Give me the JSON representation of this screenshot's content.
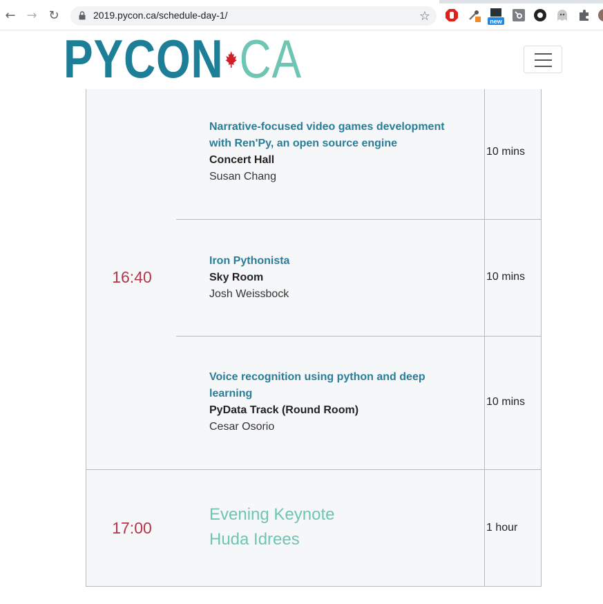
{
  "browser": {
    "url": "2019.pycon.ca/schedule-day-1/",
    "extensions": [
      "adblock-icon",
      "eyedropper-icon",
      "new-extension-icon",
      "hubspot-icon",
      "github-icon",
      "ghost-icon",
      "puzzle-icon",
      "avatar"
    ],
    "new_badge": "new"
  },
  "header": {
    "logo_left": "PYCON",
    "logo_right": "CA",
    "brand_color": "#1d7f97",
    "accent_color": "#6fc5b3"
  },
  "schedule": {
    "slots": [
      {
        "time": "16:40",
        "talks": [
          {
            "title_lines": [
              "Narrative-focused video games development",
              "with Ren'Py, an open source engine"
            ],
            "room": "Concert Hall",
            "speaker": "Susan Chang",
            "duration": "10 mins"
          },
          {
            "title_lines": [
              "Iron Pythonista"
            ],
            "room": "Sky Room",
            "speaker": "Josh Weissbock",
            "duration": "10 mins"
          },
          {
            "title_lines": [
              "Voice recognition using python and deep",
              "learning"
            ],
            "room": "PyData Track (Round Room)",
            "speaker": "Cesar Osorio",
            "duration": "10 mins"
          }
        ]
      },
      {
        "time": "17:00",
        "keynote": {
          "title": "Evening Keynote",
          "speaker": "Huda Idrees",
          "duration": "1 hour"
        }
      }
    ]
  }
}
